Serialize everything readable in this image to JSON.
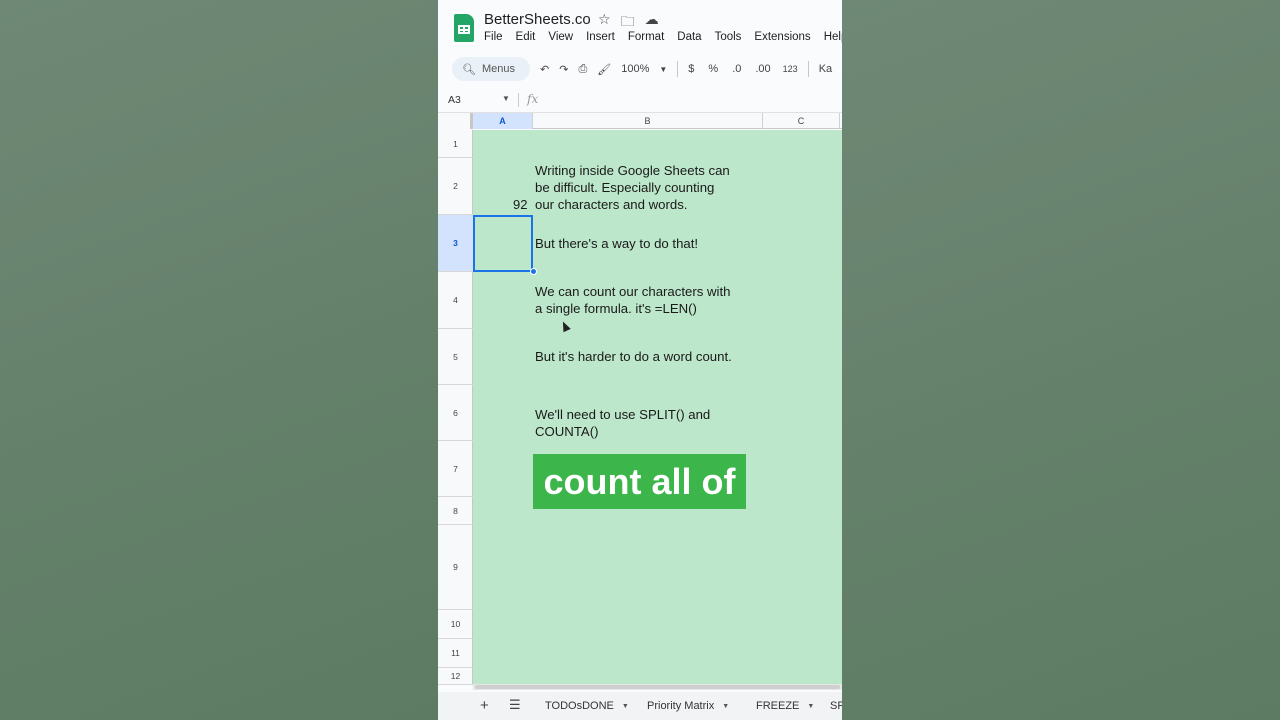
{
  "app": {
    "doc_title": "BetterSheets.co",
    "menu": [
      "File",
      "Edit",
      "View",
      "Insert",
      "Format",
      "Data",
      "Tools",
      "Extensions",
      "Help"
    ]
  },
  "toolbar": {
    "search_label": "Menus",
    "zoom": "100%",
    "currency": "$",
    "percent": "%",
    "dec_decrease": ".0",
    "dec_increase": ".00",
    "number_format": "123",
    "font_truncated": "Ka"
  },
  "formula_bar": {
    "name_box": "A3",
    "fx": "fx"
  },
  "columns": [
    "A",
    "B",
    "C"
  ],
  "rows": [
    "1",
    "2",
    "3",
    "4",
    "5",
    "6",
    "7",
    "8",
    "9",
    "10",
    "11",
    "12"
  ],
  "cells": {
    "a2_value": "92",
    "b2": "Writing inside Google Sheets can\nbe difficult. Especially counting\nour characters and words.",
    "b3": "But there's a way to do that!",
    "b4": "We can count our characters with\na single formula. it's =LEN()",
    "b5": "But it's harder to do a word count.",
    "b6": "We'll need to use SPLIT() and\nCOUNTA()"
  },
  "caption": "count all of",
  "sheet_tabs": [
    "TODOsDONE",
    "Priority Matrix",
    "FREEZE",
    "SP"
  ],
  "colors": {
    "cell_fill": "#bde7cb",
    "selection": "#1a73e8",
    "caption_bg": "#3cb54a",
    "sheets_green": "#23a566"
  }
}
